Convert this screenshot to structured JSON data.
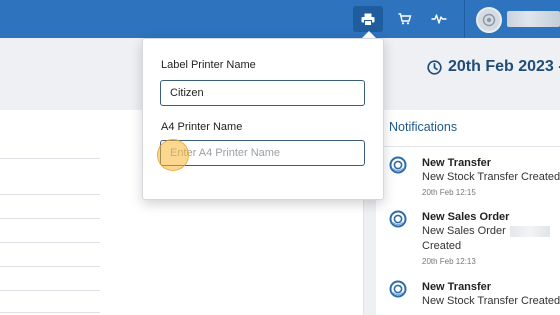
{
  "topbar": {
    "accent_color": "#2d73bd",
    "icons": [
      "printer-icon",
      "cart-icon",
      "activity-icon"
    ]
  },
  "header": {
    "date_text": "20th Feb 2023 -"
  },
  "printer_popup": {
    "label_printer_label": "Label Printer Name",
    "label_printer_value": "Citizen",
    "a4_printer_label": "A4 Printer Name",
    "a4_printer_placeholder": "Enter A4 Printer Name",
    "a4_printer_value": ""
  },
  "notifications": {
    "title": "Notifications",
    "items": [
      {
        "title": "New Transfer",
        "body": "New Stock Transfer Created",
        "time": "20th Feb 12:15"
      },
      {
        "title": "New Sales Order",
        "body_line1": "New Sales Order",
        "body_line2": "Created",
        "time": "20th Feb 12:13"
      },
      {
        "title": "New Transfer",
        "body": "New Stock Transfer Created"
      }
    ]
  }
}
